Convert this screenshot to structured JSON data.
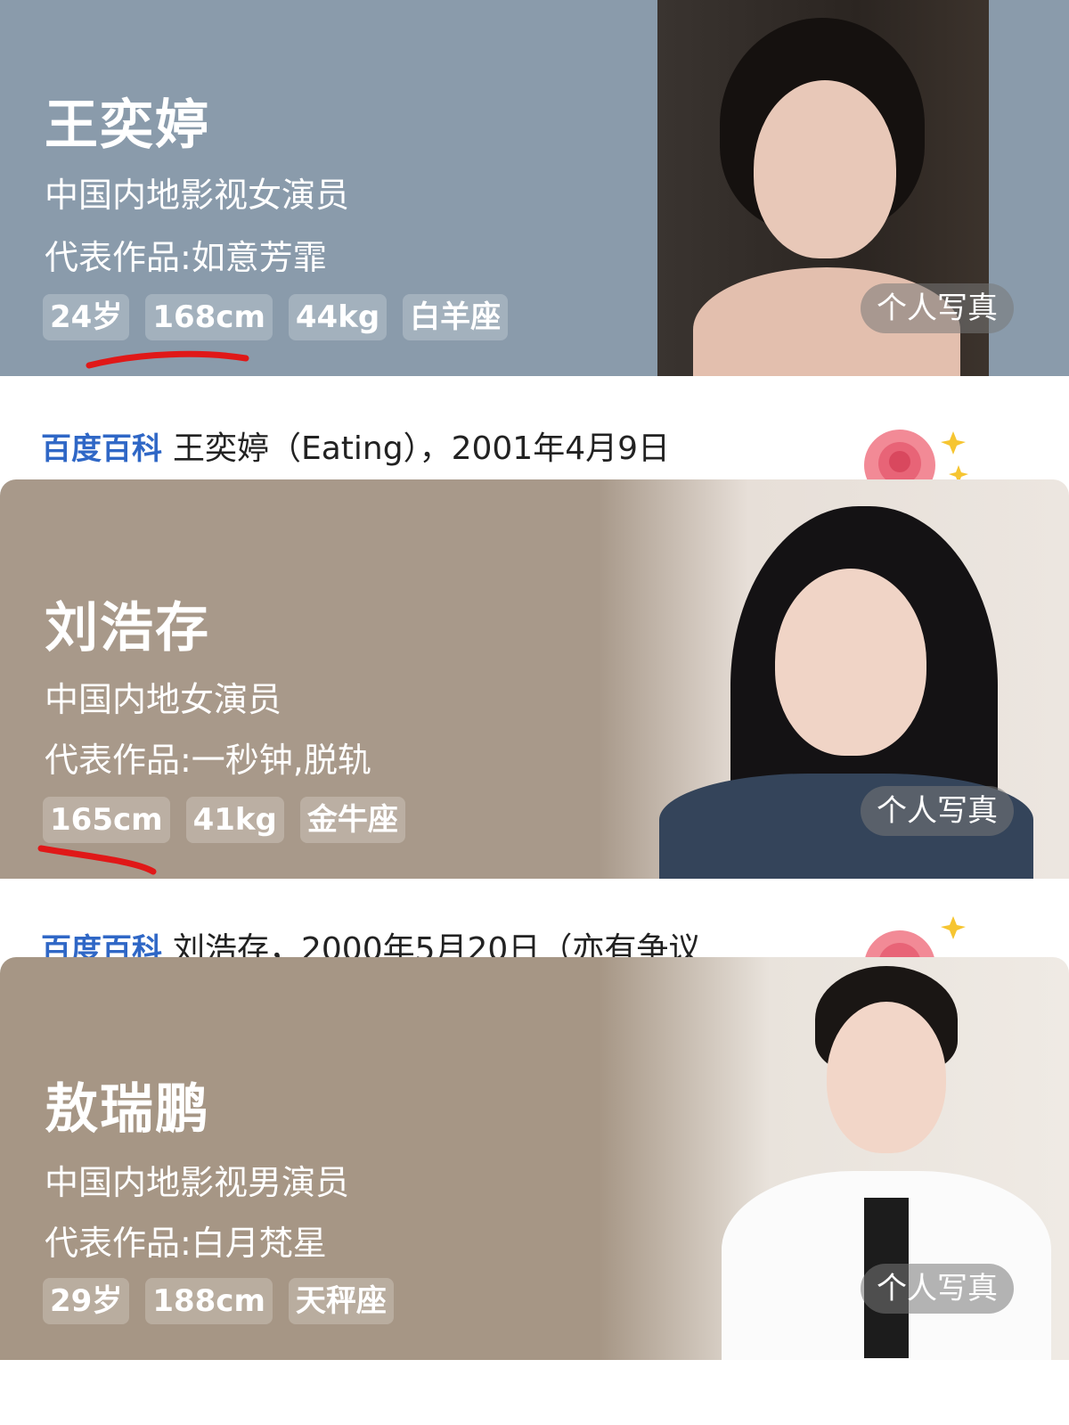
{
  "cards": [
    {
      "name": "王奕婷",
      "desc": "中国内地影视女演员",
      "works": "代表作品:如意芳霏",
      "tags": [
        "24岁",
        "168cm",
        "44kg",
        "白羊座"
      ],
      "photo_button": "个人写真",
      "bg_color": "#8a9bab"
    },
    {
      "name": "刘浩存",
      "desc": "中国内地女演员",
      "works": "代表作品:一秒钟,脱轨",
      "tags": [
        "165cm",
        "41kg",
        "金牛座"
      ],
      "photo_button": "个人写真",
      "bg_color": "#a8998a"
    },
    {
      "name": "敖瑞鹏",
      "desc": "中国内地影视男演员",
      "works": "代表作品:白月梵星",
      "tags": [
        "29岁",
        "188cm",
        "天秤座"
      ],
      "photo_button": "个人写真",
      "bg_color": "#a69685"
    }
  ],
  "baike": [
    {
      "brand": "百度百科",
      "summary": "王奕婷（Eating），2001年4月9日"
    },
    {
      "brand": "百度百科",
      "summary": "刘浩存，2000年5月20日（亦有争议"
    }
  ],
  "colors": {
    "brand_blue": "#2f67c6",
    "annotation_red": "#e01818"
  }
}
